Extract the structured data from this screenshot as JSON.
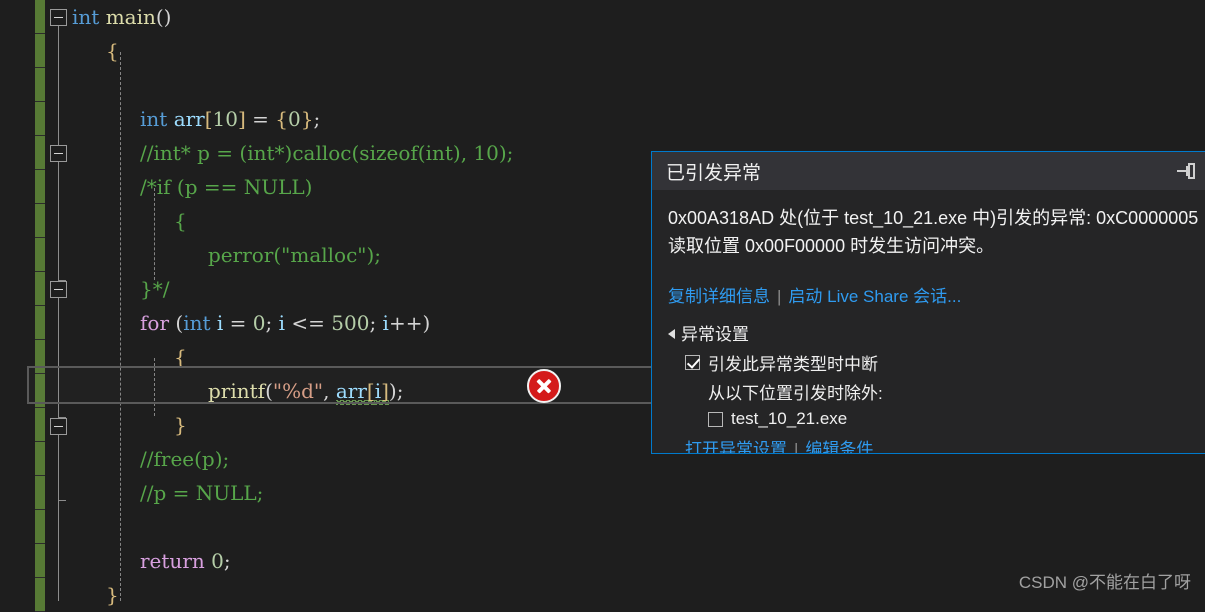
{
  "editor": {
    "lines": [
      {
        "indent": 0,
        "tokens": [
          {
            "t": "int",
            "c": "kw"
          },
          {
            "t": " ",
            "c": "pun"
          },
          {
            "t": "main",
            "c": "fn"
          },
          {
            "t": "()",
            "c": "pun"
          }
        ]
      },
      {
        "indent": 1,
        "tokens": [
          {
            "t": "{",
            "c": "brk"
          }
        ]
      },
      {
        "indent": 0,
        "tokens": []
      },
      {
        "indent": 2,
        "tokens": [
          {
            "t": "int",
            "c": "kw"
          },
          {
            "t": " ",
            "c": "pun"
          },
          {
            "t": "arr",
            "c": "id"
          },
          {
            "t": "[",
            "c": "brk"
          },
          {
            "t": "10",
            "c": "num"
          },
          {
            "t": "]",
            "c": "brk"
          },
          {
            "t": " = ",
            "c": "pun"
          },
          {
            "t": "{",
            "c": "brk"
          },
          {
            "t": "0",
            "c": "num"
          },
          {
            "t": "}",
            "c": "brk"
          },
          {
            "t": ";",
            "c": "pun"
          }
        ]
      },
      {
        "indent": 2,
        "tokens": [
          {
            "t": "//int* p = (int*)calloc(sizeof(int), 10);",
            "c": "cmt"
          }
        ]
      },
      {
        "indent": 2,
        "tokens": [
          {
            "t": "/*if (p == NULL)",
            "c": "cmt"
          }
        ]
      },
      {
        "indent": 3,
        "tokens": [
          {
            "t": "{",
            "c": "cmt"
          }
        ]
      },
      {
        "indent": 4,
        "tokens": [
          {
            "t": "perror(\"malloc\");",
            "c": "cmt"
          }
        ]
      },
      {
        "indent": 2,
        "tokens": [
          {
            "t": "}*/",
            "c": "cmt"
          }
        ]
      },
      {
        "indent": 2,
        "tokens": [
          {
            "t": "for",
            "c": "ctrl"
          },
          {
            "t": " (",
            "c": "pun"
          },
          {
            "t": "int",
            "c": "kw"
          },
          {
            "t": " ",
            "c": "pun"
          },
          {
            "t": "i",
            "c": "id"
          },
          {
            "t": " = ",
            "c": "pun"
          },
          {
            "t": "0",
            "c": "num"
          },
          {
            "t": "; ",
            "c": "pun"
          },
          {
            "t": "i",
            "c": "id"
          },
          {
            "t": " <= ",
            "c": "pun"
          },
          {
            "t": "500",
            "c": "num"
          },
          {
            "t": "; ",
            "c": "pun"
          },
          {
            "t": "i",
            "c": "id"
          },
          {
            "t": "++)",
            "c": "pun"
          }
        ]
      },
      {
        "indent": 3,
        "tokens": [
          {
            "t": "{",
            "c": "brk"
          }
        ]
      },
      {
        "indent": 4,
        "tokens": [
          {
            "t": "printf",
            "c": "fn"
          },
          {
            "t": "(",
            "c": "pun"
          },
          {
            "t": "\"%d\"",
            "c": "str"
          },
          {
            "t": ", ",
            "c": "pun"
          },
          {
            "t": "arr",
            "c": "id squig"
          },
          {
            "t": "[",
            "c": "brk squig"
          },
          {
            "t": "i",
            "c": "id squig"
          },
          {
            "t": "]",
            "c": "brk squig"
          },
          {
            "t": ")",
            "c": "pun"
          },
          {
            "t": ";",
            "c": "pun"
          }
        ]
      },
      {
        "indent": 3,
        "tokens": [
          {
            "t": "}",
            "c": "brk"
          }
        ]
      },
      {
        "indent": 2,
        "tokens": [
          {
            "t": "//free(p);",
            "c": "cmt"
          }
        ]
      },
      {
        "indent": 2,
        "tokens": [
          {
            "t": "//p = NULL;",
            "c": "cmt"
          }
        ]
      },
      {
        "indent": 0,
        "tokens": []
      },
      {
        "indent": 2,
        "tokens": [
          {
            "t": "return",
            "c": "ctrl"
          },
          {
            "t": " ",
            "c": "pun"
          },
          {
            "t": "0",
            "c": "num"
          },
          {
            "t": ";",
            "c": "pun"
          }
        ]
      },
      {
        "indent": 1,
        "tokens": [
          {
            "t": "}",
            "c": "brk"
          }
        ]
      }
    ],
    "error_glyph": "error-circle-x-icon",
    "squiggle_target": "arr[i]"
  },
  "exception_dialog": {
    "title": "已引发异常",
    "pin_icon": "pin-icon",
    "message_line1": "0x00A318AD 处(位于 test_10_21.exe 中)引发的异常: 0xC0000005",
    "message_line2": "读取位置 0x00F00000 时发生访问冲突。",
    "links": {
      "copy_details": "复制详细信息",
      "separator": "|",
      "live_share": "启动 Live Share 会话..."
    },
    "settings": {
      "header": "异常设置",
      "break_when_thrown": {
        "label": "引发此异常类型时中断",
        "checked": true
      },
      "except_when_thrown_from": "从以下位置引发时除外:",
      "module": {
        "label": "test_10_21.exe",
        "checked": false
      },
      "bottom_links": {
        "open_exception_settings": "打开异常设置",
        "separator": "|",
        "edit_conditions": "编辑条件"
      }
    }
  },
  "watermark": {
    "text": "CSDN @不能在白了呀"
  },
  "colors": {
    "editor_background": "#1e1e1e",
    "change_bar_green": "#577a35",
    "dialog_border_blue": "#007acc",
    "dialog_title_bg": "#333337",
    "dialog_body_bg": "#252526",
    "link_blue": "#2f9bf0",
    "error_red": "#d41a1a",
    "keyword_blue": "#569cd6",
    "control_pink": "#d8a0df",
    "identifier_lightblue": "#9cdcfe",
    "function_yellow": "#dcdcaa",
    "number_green": "#b5cea8",
    "string_orange": "#d69d85",
    "comment_green": "#57a64a",
    "squiggle_green": "#7fbf5f"
  }
}
